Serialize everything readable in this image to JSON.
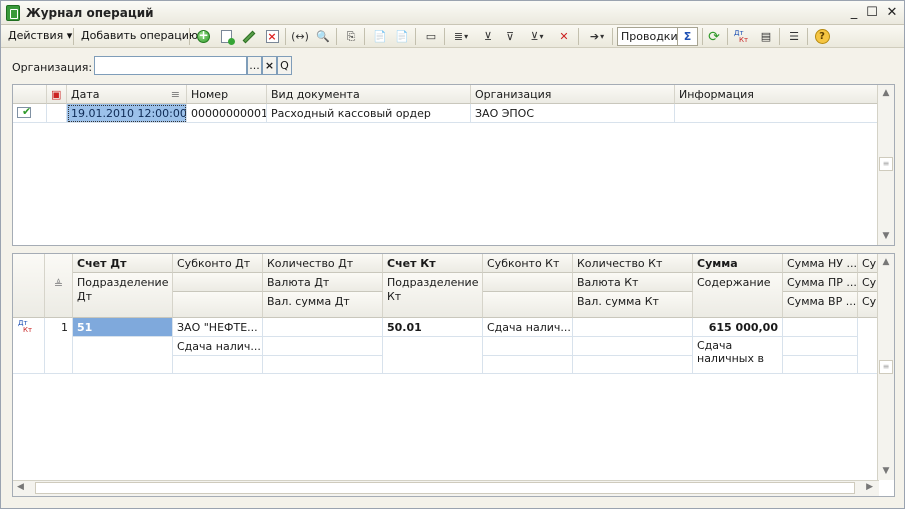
{
  "window": {
    "title": "Журнал операций"
  },
  "toolbar": {
    "actions_label": "Действия",
    "add_operation_label": "Добавить операцию",
    "postings_label": "Проводки"
  },
  "filter": {
    "org_label": "Организация:",
    "org_value": "",
    "ellipsis": "...",
    "clear": "×",
    "search": "Q"
  },
  "journal": {
    "headers": [
      "Дата",
      "Номер",
      "Вид документа",
      "Организация",
      "Информация"
    ],
    "rows": [
      {
        "date": "19.01.2010 12:00:00",
        "number": "00000000001",
        "doc_type": "Расходный кассовый ордер",
        "org": "ЗАО ЭПОС",
        "info": ""
      }
    ]
  },
  "postings": {
    "headers_row1": [
      "Счет Дт",
      "Субконто Дт",
      "Количество Дт",
      "Счет Кт",
      "Субконто Кт",
      "Количество Кт",
      "Сумма",
      "Сумма НУ ...",
      "Су"
    ],
    "headers_row2": [
      "Подразделение Дт",
      "",
      "Валюта Дт",
      "Подразделение Кт",
      "",
      "Валюта Кт",
      "Содержание",
      "Сумма ПР ...",
      "Су"
    ],
    "headers_row3": [
      "",
      "",
      "Вал. сумма Дт",
      "",
      "",
      "Вал. сумма Кт",
      "",
      "Сумма ВР ...",
      "Су"
    ],
    "rows": [
      {
        "n": "1",
        "dt_account": "51",
        "subconto_dt": "ЗАО \"НЕФТЕ...",
        "subconto_dt2": "Сдача налич...",
        "kt_account": "50.01",
        "subconto_kt": "Сдача налич...",
        "amount": "615 000,00",
        "content_line1": "Сдача",
        "content_line2": "наличных в"
      }
    ],
    "dt_tag": "Дт",
    "kt_tag": "Кт"
  }
}
